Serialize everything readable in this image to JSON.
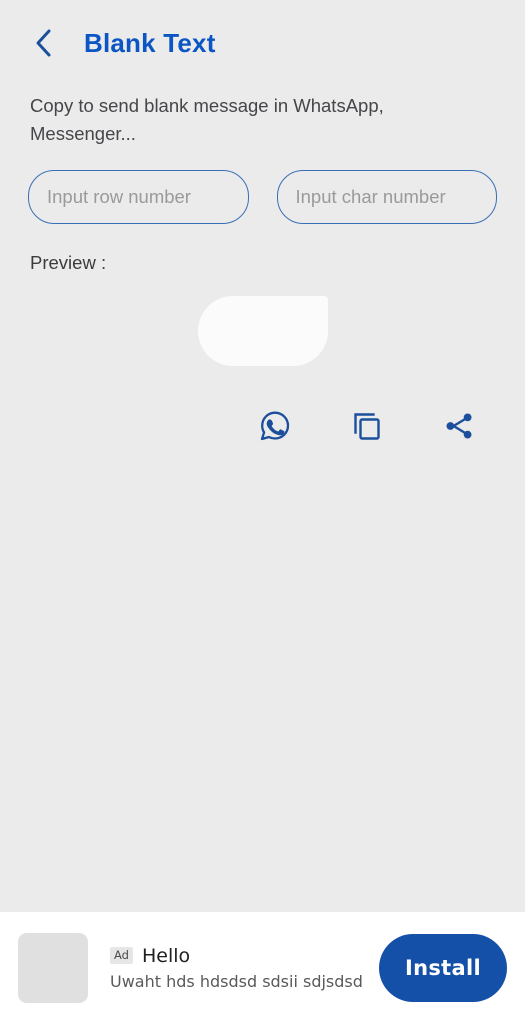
{
  "header": {
    "back_icon": "chevron-left-icon",
    "title": "Blank Text"
  },
  "main": {
    "description": "Copy to send blank message in WhatsApp, Messenger...",
    "inputs": {
      "row": {
        "placeholder": "Input row number",
        "value": ""
      },
      "char": {
        "placeholder": "Input char number",
        "value": ""
      }
    },
    "preview_label": "Preview :",
    "actions": [
      {
        "name": "whatsapp-icon",
        "label": "Send to WhatsApp"
      },
      {
        "name": "copy-icon",
        "label": "Copy"
      },
      {
        "name": "share-icon",
        "label": "Share"
      }
    ]
  },
  "ad": {
    "badge": "Ad",
    "headline": "Hello",
    "subtitle": "Uwaht hds hdsdsd sdsii sdjsdsd",
    "install_label": "Install"
  },
  "colors": {
    "background": "#ebebeb",
    "title_blue": "#0b56c4",
    "icon_blue": "#1b4f9c",
    "input_border": "#3a6fb5",
    "install_blue": "#1450a8",
    "bubble": "#fbfbfc"
  }
}
